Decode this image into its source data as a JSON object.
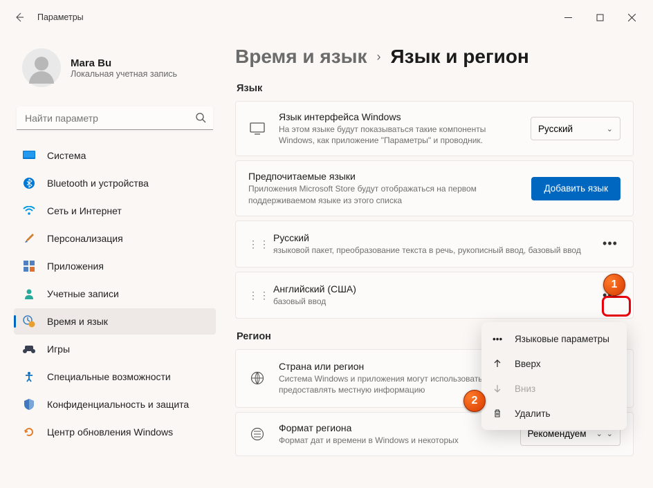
{
  "window": {
    "title": "Параметры"
  },
  "profile": {
    "name": "Mara Bu",
    "subtitle": "Локальная учетная запись"
  },
  "search": {
    "placeholder": "Найти параметр"
  },
  "sidebar": {
    "items": [
      {
        "label": "Система"
      },
      {
        "label": "Bluetooth и устройства"
      },
      {
        "label": "Сеть и Интернет"
      },
      {
        "label": "Персонализация"
      },
      {
        "label": "Приложения"
      },
      {
        "label": "Учетные записи"
      },
      {
        "label": "Время и язык"
      },
      {
        "label": "Игры"
      },
      {
        "label": "Специальные возможности"
      },
      {
        "label": "Конфиденциальность и защита"
      },
      {
        "label": "Центр обновления Windows"
      }
    ]
  },
  "breadcrumb": {
    "parent": "Время и язык",
    "current": "Язык и регион"
  },
  "sections": {
    "language": "Язык",
    "region": "Регион"
  },
  "display_language": {
    "title": "Язык интерфейса Windows",
    "desc": "На этом языке будут показываться такие компоненты Windows, как приложение \"Параметры\" и проводник.",
    "value": "Русский"
  },
  "preferred": {
    "title": "Предпочитаемые языки",
    "desc": "Приложения Microsoft Store будут отображаться на первом поддерживаемом языке из этого списка",
    "add_btn": "Добавить язык"
  },
  "languages": [
    {
      "name": "Русский",
      "desc": "языковой пакет, преобразование текста в речь, рукописный ввод, базовый ввод"
    },
    {
      "name": "Английский (США)",
      "desc": "базовый ввод"
    }
  ],
  "region_card": {
    "title": "Страна или регион",
    "desc": "Система Windows и приложения могут использовать данные о стране и регионе, чтобы предоставлять местную информацию"
  },
  "format_card": {
    "title": "Формат региона",
    "desc": "Формат дат и времени в Windows и некоторых",
    "value": "Рекомендуем"
  },
  "context_menu": {
    "options": "Языковые параметры",
    "up": "Вверх",
    "down": "Вниз",
    "delete": "Удалить"
  },
  "annotations": {
    "one": "1",
    "two": "2"
  }
}
